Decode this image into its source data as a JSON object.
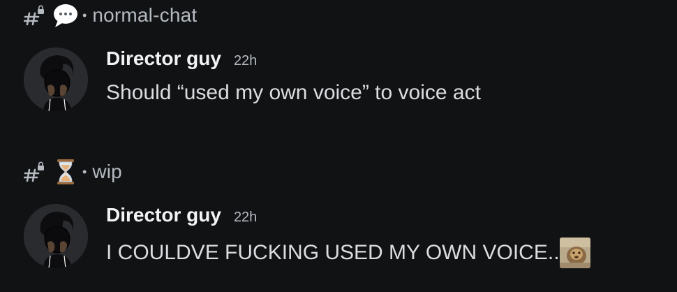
{
  "threads": [
    {
      "channel": {
        "name": "normal-chat",
        "icon": "speech-bubble-icon",
        "separator": "•"
      },
      "message": {
        "author": "Director guy",
        "timestamp": "22h",
        "text": "Should “used my own voice” to voice act"
      }
    },
    {
      "channel": {
        "name": "wip",
        "icon": "hourglass-icon",
        "separator": "•"
      },
      "message": {
        "author": "Director guy",
        "timestamp": "22h",
        "text": "I COULDVE FUCKING USED MY OWN VOICE..",
        "attachment_icon": "reaction-image-emoji"
      }
    }
  ],
  "colors": {
    "background": "#111214",
    "muted_text": "#b5bac1",
    "message_text": "#dbdee1",
    "username": "#f2f3f5"
  }
}
